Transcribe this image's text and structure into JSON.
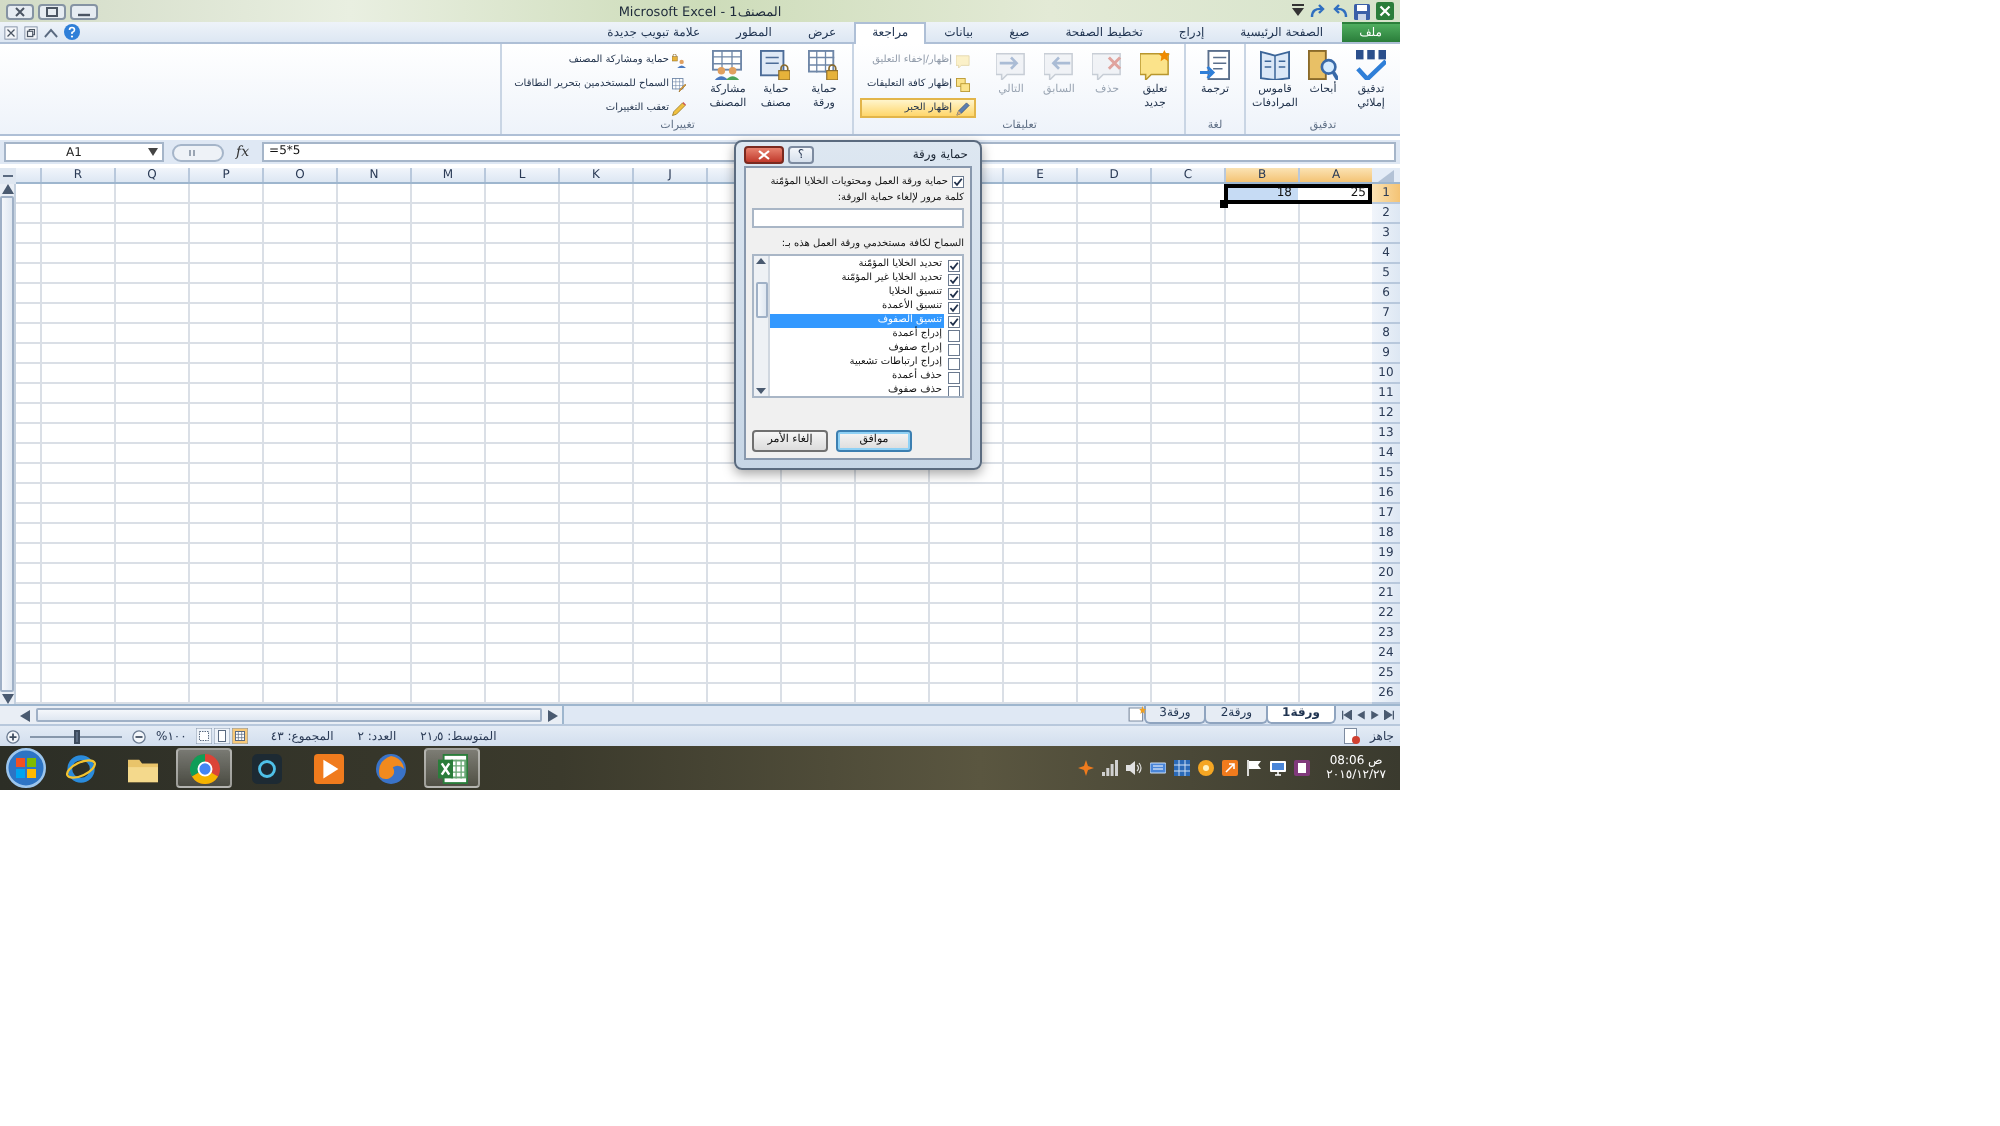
{
  "window": {
    "title": "المصنف1 - Microsoft Excel"
  },
  "ribbon": {
    "tabs": [
      {
        "label": "ملف",
        "kind": "file",
        "selected": false
      },
      {
        "label": "الصفحة الرئيسية",
        "kind": "tab",
        "selected": false
      },
      {
        "label": "إدراج",
        "kind": "tab",
        "selected": false
      },
      {
        "label": "تخطيط الصفحة",
        "kind": "tab",
        "selected": false
      },
      {
        "label": "صيغ",
        "kind": "tab",
        "selected": false
      },
      {
        "label": "بيانات",
        "kind": "tab",
        "selected": false
      },
      {
        "label": "مراجعة",
        "kind": "tab",
        "selected": true
      },
      {
        "label": "عرض",
        "kind": "tab",
        "selected": false
      },
      {
        "label": "المطور",
        "kind": "tab",
        "selected": false
      },
      {
        "label": "علامة تبويب جديدة",
        "kind": "tab",
        "selected": false
      }
    ],
    "groups": [
      {
        "label": "تدقيق",
        "buttons": [
          {
            "label": "تدقيق إملائي",
            "kind": "large",
            "disabled": false,
            "on": false
          },
          {
            "label": "أبحاث",
            "kind": "large",
            "disabled": false,
            "on": false
          },
          {
            "label": "قاموس المرادفات",
            "kind": "large",
            "disabled": false,
            "on": false
          }
        ]
      },
      {
        "label": "لغة",
        "buttons": [
          {
            "label": "ترجمة",
            "kind": "large",
            "disabled": false,
            "on": false
          }
        ]
      },
      {
        "label": "تعليقات",
        "buttons": [
          {
            "label": "تعليق جديد",
            "kind": "large",
            "disabled": false,
            "on": false
          },
          {
            "label": "حذف",
            "kind": "large",
            "disabled": true,
            "on": false
          },
          {
            "label": "السابق",
            "kind": "large",
            "disabled": true,
            "on": false
          },
          {
            "label": "التالي",
            "kind": "large",
            "disabled": true,
            "on": false
          },
          {
            "label": "إظهار/إخفاء التعليق",
            "kind": "small",
            "disabled": true,
            "on": false
          },
          {
            "label": "إظهار كافة التعليقات",
            "kind": "small",
            "disabled": false,
            "on": false
          },
          {
            "label": "إظهار الحبر",
            "kind": "small",
            "disabled": false,
            "on": true
          }
        ]
      },
      {
        "label": "تغييرات",
        "buttons": [
          {
            "label": "حماية ورقة",
            "kind": "large",
            "disabled": false,
            "on": false
          },
          {
            "label": "حماية مصنف",
            "kind": "large",
            "disabled": false,
            "on": false
          },
          {
            "label": "مشاركة المصنف",
            "kind": "large",
            "disabled": false,
            "on": false
          },
          {
            "label": "حماية ومشاركة المصنف",
            "kind": "small",
            "disabled": false,
            "on": false
          },
          {
            "label": "السماح للمستخدمين بتحرير النطاقات",
            "kind": "small",
            "disabled": false,
            "on": false
          },
          {
            "label": "تعقب التغييرات",
            "kind": "small",
            "disabled": false,
            "on": false
          }
        ]
      }
    ]
  },
  "formula_bar": {
    "name_box": "A1",
    "function_button": "fx",
    "formula": "=5*5"
  },
  "sheet": {
    "columns": [
      {
        "label": "A",
        "selected": true
      },
      {
        "label": "B",
        "selected": true
      },
      {
        "label": "C",
        "selected": false
      },
      {
        "label": "D",
        "selected": false
      },
      {
        "label": "E",
        "selected": false
      }
    ],
    "columns_past_dialog": [
      {
        "label": "J",
        "selected": false
      },
      {
        "label": "K",
        "selected": false
      },
      {
        "label": "L",
        "selected": false
      },
      {
        "label": "M",
        "selected": false
      },
      {
        "label": "N",
        "selected": false
      },
      {
        "label": "O",
        "selected": false
      },
      {
        "label": "P",
        "selected": false
      },
      {
        "label": "Q",
        "selected": false
      },
      {
        "label": "R",
        "selected": false
      }
    ],
    "rows": [
      {
        "label": "1",
        "selected": true,
        "cells": [
          {
            "value": "25",
            "selected": true,
            "active": true
          },
          {
            "value": "18",
            "selected": true,
            "active": false
          }
        ]
      },
      {
        "label": "2",
        "selected": false
      },
      {
        "label": "3",
        "selected": false
      },
      {
        "label": "4",
        "selected": false
      },
      {
        "label": "5",
        "selected": false
      },
      {
        "label": "6",
        "selected": false
      },
      {
        "label": "7",
        "selected": false
      },
      {
        "label": "8",
        "selected": false
      },
      {
        "label": "9",
        "selected": false
      },
      {
        "label": "10",
        "selected": false
      },
      {
        "label": "11",
        "selected": false
      },
      {
        "label": "12",
        "selected": false
      },
      {
        "label": "13",
        "selected": false
      },
      {
        "label": "14",
        "selected": false
      },
      {
        "label": "15",
        "selected": false
      },
      {
        "label": "16",
        "selected": false
      },
      {
        "label": "17",
        "selected": false
      },
      {
        "label": "18",
        "selected": false
      },
      {
        "label": "19",
        "selected": false
      },
      {
        "label": "20",
        "selected": false
      },
      {
        "label": "21",
        "selected": false
      },
      {
        "label": "22",
        "selected": false
      },
      {
        "label": "23",
        "selected": false
      },
      {
        "label": "24",
        "selected": false
      },
      {
        "label": "25",
        "selected": false
      },
      {
        "label": "26",
        "selected": false
      }
    ]
  },
  "dialog": {
    "title": "حماية ورقة",
    "help_button": "؟",
    "protect": {
      "label": "حماية ورقة العمل ومحتويات الخلايا المؤمّنة",
      "checked": true
    },
    "password_label": "كلمة مرور لإلغاء حماية الورقة:",
    "allow_label": "السماح لكافة مستخدمي ورقة العمل هذه بـ:",
    "permissions": [
      {
        "label": "تحديد الخلايا المؤمّنة",
        "checked": true,
        "selected": false
      },
      {
        "label": "تحديد الخلايا غير المؤمّنة",
        "checked": true,
        "selected": false
      },
      {
        "label": "تنسيق الخلايا",
        "checked": true,
        "selected": false
      },
      {
        "label": "تنسيق الأعمدة",
        "checked": true,
        "selected": false
      },
      {
        "label": "تنسيق الصفوف",
        "checked": true,
        "selected": true
      },
      {
        "label": "إدراج أعمدة",
        "checked": false,
        "selected": false
      },
      {
        "label": "إدراج صفوف",
        "checked": false,
        "selected": false
      },
      {
        "label": "إدراج ارتباطات تشعبية",
        "checked": false,
        "selected": false
      },
      {
        "label": "حذف أعمدة",
        "checked": false,
        "selected": false
      },
      {
        "label": "حذف صفوف",
        "checked": false,
        "selected": false
      }
    ],
    "buttons": [
      {
        "label": "موافق",
        "default": true
      },
      {
        "label": "إلغاء الأمر",
        "default": false
      }
    ]
  },
  "sheet_tabs": [
    {
      "label": "ورقة1",
      "selected": true
    },
    {
      "label": "ورقة2",
      "selected": false
    },
    {
      "label": "ورقة3",
      "selected": false
    }
  ],
  "status_bar": {
    "mode": "جاهز",
    "stats": [
      "المتوسط: ٢١٫٥",
      "العدد: ٢",
      "المجموع: ٤٣"
    ],
    "views": [
      {
        "selected": true
      },
      {
        "selected": false
      },
      {
        "selected": false
      }
    ],
    "zoom": "١٠٠%",
    "zoom_slider": {
      "level": 0.5
    }
  },
  "taskbar": {
    "apps": [
      {
        "running": false
      },
      {
        "running": false
      },
      {
        "running": true
      },
      {
        "running": false
      },
      {
        "running": false
      },
      {
        "running": false
      },
      {
        "running": true
      }
    ],
    "time": "08:06 ص",
    "date": "٢٠١٥/١٢/٢٧"
  }
}
